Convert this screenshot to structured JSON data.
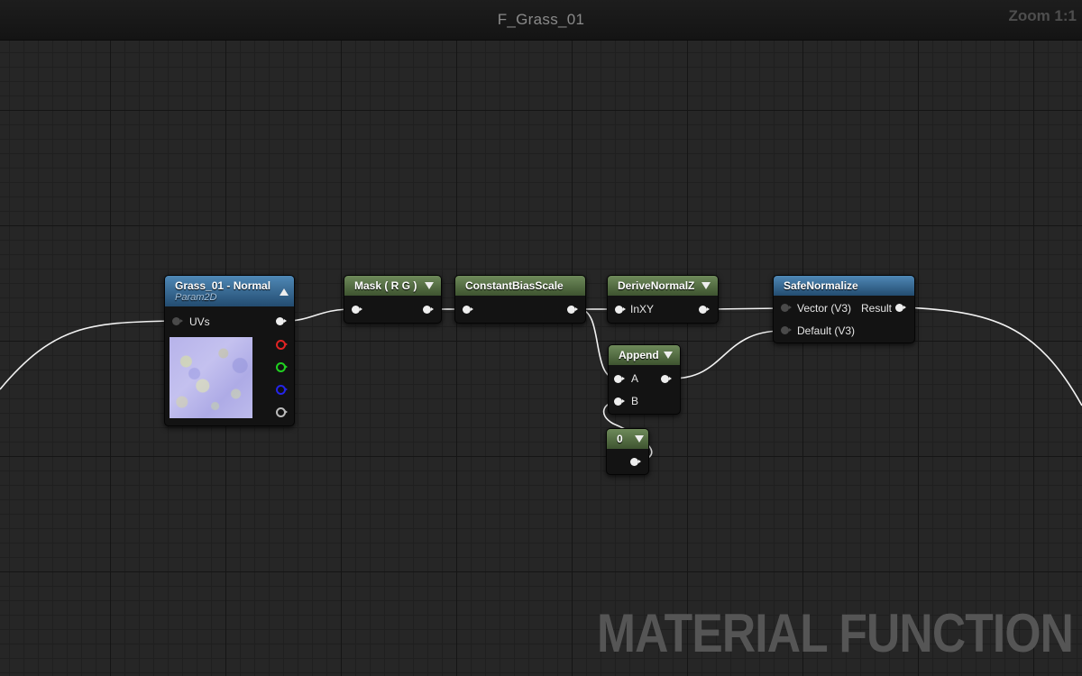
{
  "graph": {
    "title": "F_Grass_01",
    "zoom_label": "Zoom 1:1",
    "watermark": "MATERIAL FUNCTION"
  },
  "nodes": {
    "texture_param": {
      "title": "Grass_01 - Normal",
      "subtitle": "Param2D",
      "inputs": [
        "UVs"
      ],
      "texture_icon": "normal-map-texture"
    },
    "mask": {
      "title": "Mask ( R G )"
    },
    "constant_bias_scale": {
      "title": "ConstantBiasScale"
    },
    "derive_normal_z": {
      "title": "DeriveNormalZ",
      "inputs": [
        "InXY"
      ]
    },
    "append": {
      "title": "Append",
      "inputs": [
        "A",
        "B"
      ]
    },
    "constant": {
      "title": "0"
    },
    "safe_normalize": {
      "title": "SafeNormalize",
      "inputs": [
        "Vector (V3)",
        "Default (V3)"
      ],
      "outputs": [
        "Result"
      ]
    }
  },
  "colors": {
    "header_green": "#3e5430",
    "header_blue": "#234c70",
    "pin_red": "#e02424",
    "pin_green": "#21d021",
    "pin_blue": "#2424e8",
    "wire": "#ffffff"
  }
}
